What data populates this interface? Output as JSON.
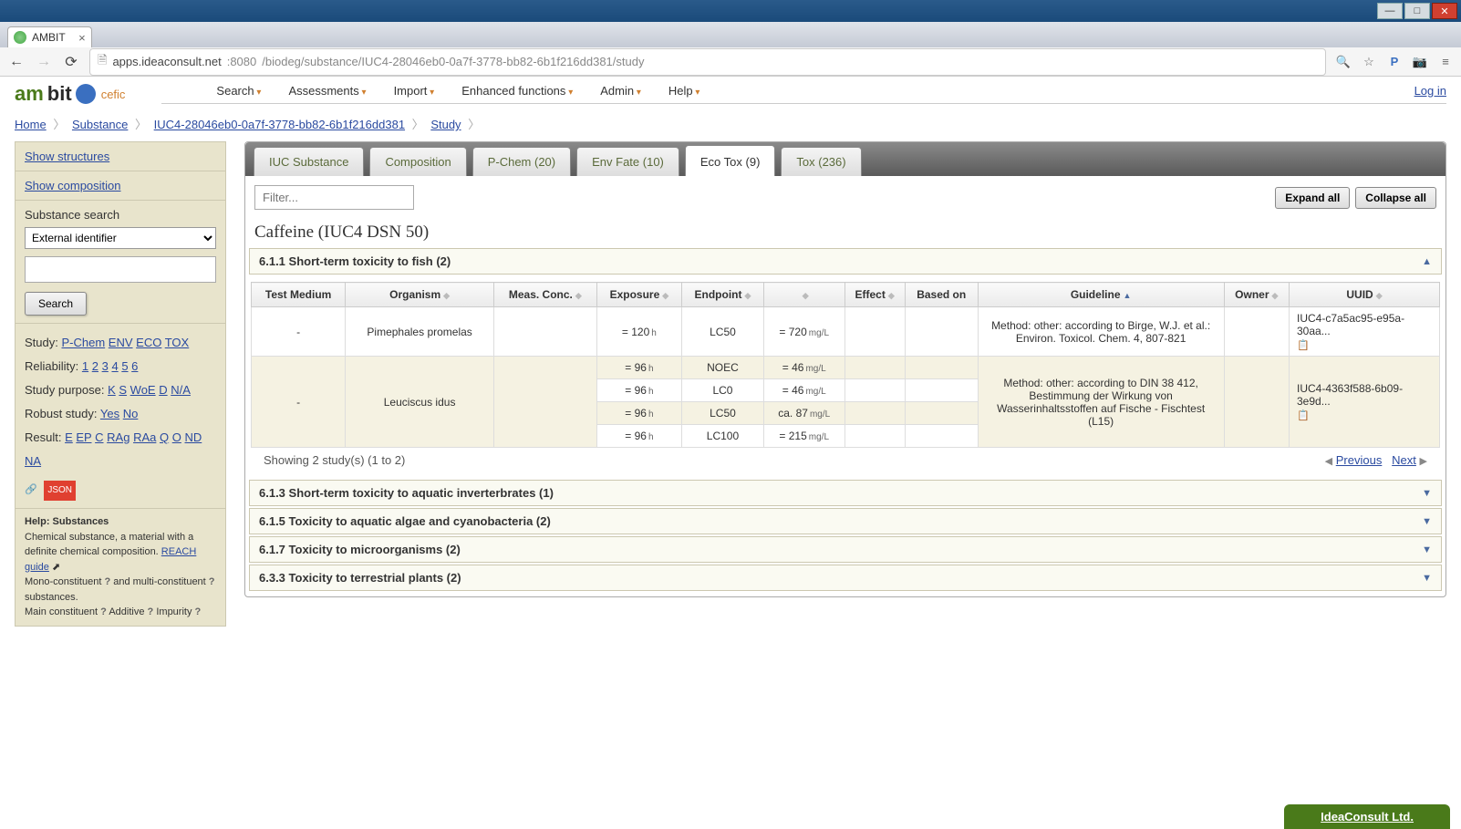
{
  "browser": {
    "tab_title": "AMBIT",
    "url_host": "apps.ideaconsult.net",
    "url_port": ":8080",
    "url_path": "/biodeg/substance/IUC4-28046eb0-0a7f-3778-bb82-6b1f216dd381/study"
  },
  "menu": {
    "items": [
      "Search",
      "Assessments",
      "Import",
      "Enhanced functions",
      "Admin",
      "Help"
    ],
    "login": "Log in"
  },
  "breadcrumb": {
    "items": [
      "Home",
      "Substance",
      "IUC4-28046eb0-0a7f-3778-bb82-6b1f216dd381",
      "Study"
    ]
  },
  "sidebar": {
    "show_structures": "Show structures",
    "show_composition": "Show composition",
    "substance_search": "Substance search",
    "identifier_select": "External identifier",
    "search_btn": "Search",
    "filters": {
      "study_label": "Study:",
      "study_links": [
        "P-Chem",
        "ENV",
        "ECO",
        "TOX"
      ],
      "reliability_label": "Reliability:",
      "reliability_links": [
        "1",
        "2",
        "3",
        "4",
        "5",
        "6"
      ],
      "purpose_label": "Study purpose:",
      "purpose_links": [
        "K",
        "S",
        "WoE",
        "D",
        "N/A"
      ],
      "robust_label": "Robust study:",
      "robust_links": [
        "Yes",
        "No"
      ],
      "result_label": "Result:",
      "result_links": [
        "E",
        "EP",
        "C",
        "RAg",
        "RAa",
        "Q",
        "O",
        "ND",
        "NA"
      ]
    },
    "help": {
      "title": "Help: Substances",
      "text": "Chemical substance, a material with a definite chemical composition. ",
      "reach_link": "REACH guide",
      "line2_a": "Mono-constituent ",
      "line2_b": " and multi-constituent ",
      "line2_c": " substances.",
      "line3_a": "Main constituent ",
      "line3_b": " Additive ",
      "line3_c": " Impurity "
    },
    "json_badge": "JSON"
  },
  "tabs": {
    "items": [
      "IUC Substance",
      "Composition",
      "P-Chem (20)",
      "Env Fate (10)",
      "Eco Tox (9)",
      "Tox (236)"
    ],
    "active_index": 4
  },
  "toolbar": {
    "filter_placeholder": "Filter...",
    "expand": "Expand all",
    "collapse": "Collapse all"
  },
  "substance_title": "Caffeine (IUC4 DSN 50)",
  "sections": {
    "s611": "6.1.1 Short-term toxicity to fish (2)",
    "s613": "6.1.3 Short-term toxicity to aquatic inverterbrates (1)",
    "s615": "6.1.5 Toxicity to aquatic algae and cyanobacteria (2)",
    "s617": "6.1.7 Toxicity to microorganisms (2)",
    "s633": "6.3.3 Toxicity to terrestrial plants (2)"
  },
  "table": {
    "headers": [
      "Test Medium",
      "Organism",
      "Meas. Conc.",
      "Exposure",
      "Endpoint",
      "",
      "Effect",
      "Based on",
      "Guideline",
      "Owner",
      "UUID"
    ],
    "rows": [
      {
        "medium": "-",
        "organism": "Pimephales promelas",
        "subrows": [
          {
            "exposure_val": "= 120",
            "exposure_unit": "h",
            "endpoint": "LC50",
            "value": "= 720",
            "unit": "mg/L"
          }
        ],
        "guideline": "Method: other: according to Birge, W.J. et al.: Environ. Toxicol. Chem. 4, 807-821",
        "uuid": "IUC4-c7a5ac95-e95a-30aa..."
      },
      {
        "medium": "-",
        "organism": "Leuciscus idus",
        "subrows": [
          {
            "exposure_val": "= 96",
            "exposure_unit": "h",
            "endpoint": "NOEC",
            "value": "= 46",
            "unit": "mg/L"
          },
          {
            "exposure_val": "= 96",
            "exposure_unit": "h",
            "endpoint": "LC0",
            "value": "= 46",
            "unit": "mg/L"
          },
          {
            "exposure_val": "= 96",
            "exposure_unit": "h",
            "endpoint": "LC50",
            "value": "ca. 87",
            "unit": "mg/L"
          },
          {
            "exposure_val": "= 96",
            "exposure_unit": "h",
            "endpoint": "LC100",
            "value": "= 215",
            "unit": "mg/L"
          }
        ],
        "guideline": "Method: other: according to DIN 38 412, Bestimmung der Wirkung von Wasserinhaltsstoffen auf Fische - Fischtest (L15)",
        "uuid": "IUC4-4363f588-6b09-3e9d..."
      }
    ],
    "footer_info": "Showing 2 study(s) (1 to 2)",
    "prev": "Previous",
    "next": "Next"
  },
  "footer": {
    "company": "IdeaConsult Ltd."
  }
}
